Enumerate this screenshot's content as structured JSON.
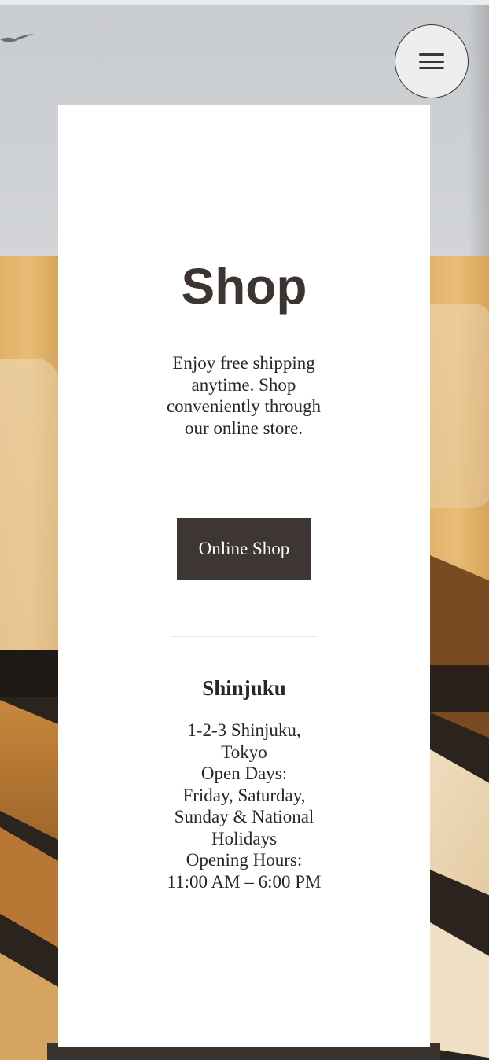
{
  "hero": {
    "menu_icon": "hamburger-menu-icon",
    "bird_icon": "bird-silhouette"
  },
  "shop": {
    "title": "Shop",
    "description": "Enjoy free shipping anytime. Shop conveniently through our online store.",
    "online_button_label": "Online Shop"
  },
  "store": {
    "name": "Shinjuku",
    "address": "1-2-3 Shinjuku, Tokyo",
    "open_days_label": "Open Days:",
    "open_days": "Friday, Saturday, Sunday & National Holidays",
    "hours_label": "Opening Hours:",
    "hours": "11:00 AM – 6:00 PM"
  },
  "colors": {
    "primary_dark": "#3d3633",
    "card_bg": "#ffffff",
    "text": "#2a2624"
  }
}
